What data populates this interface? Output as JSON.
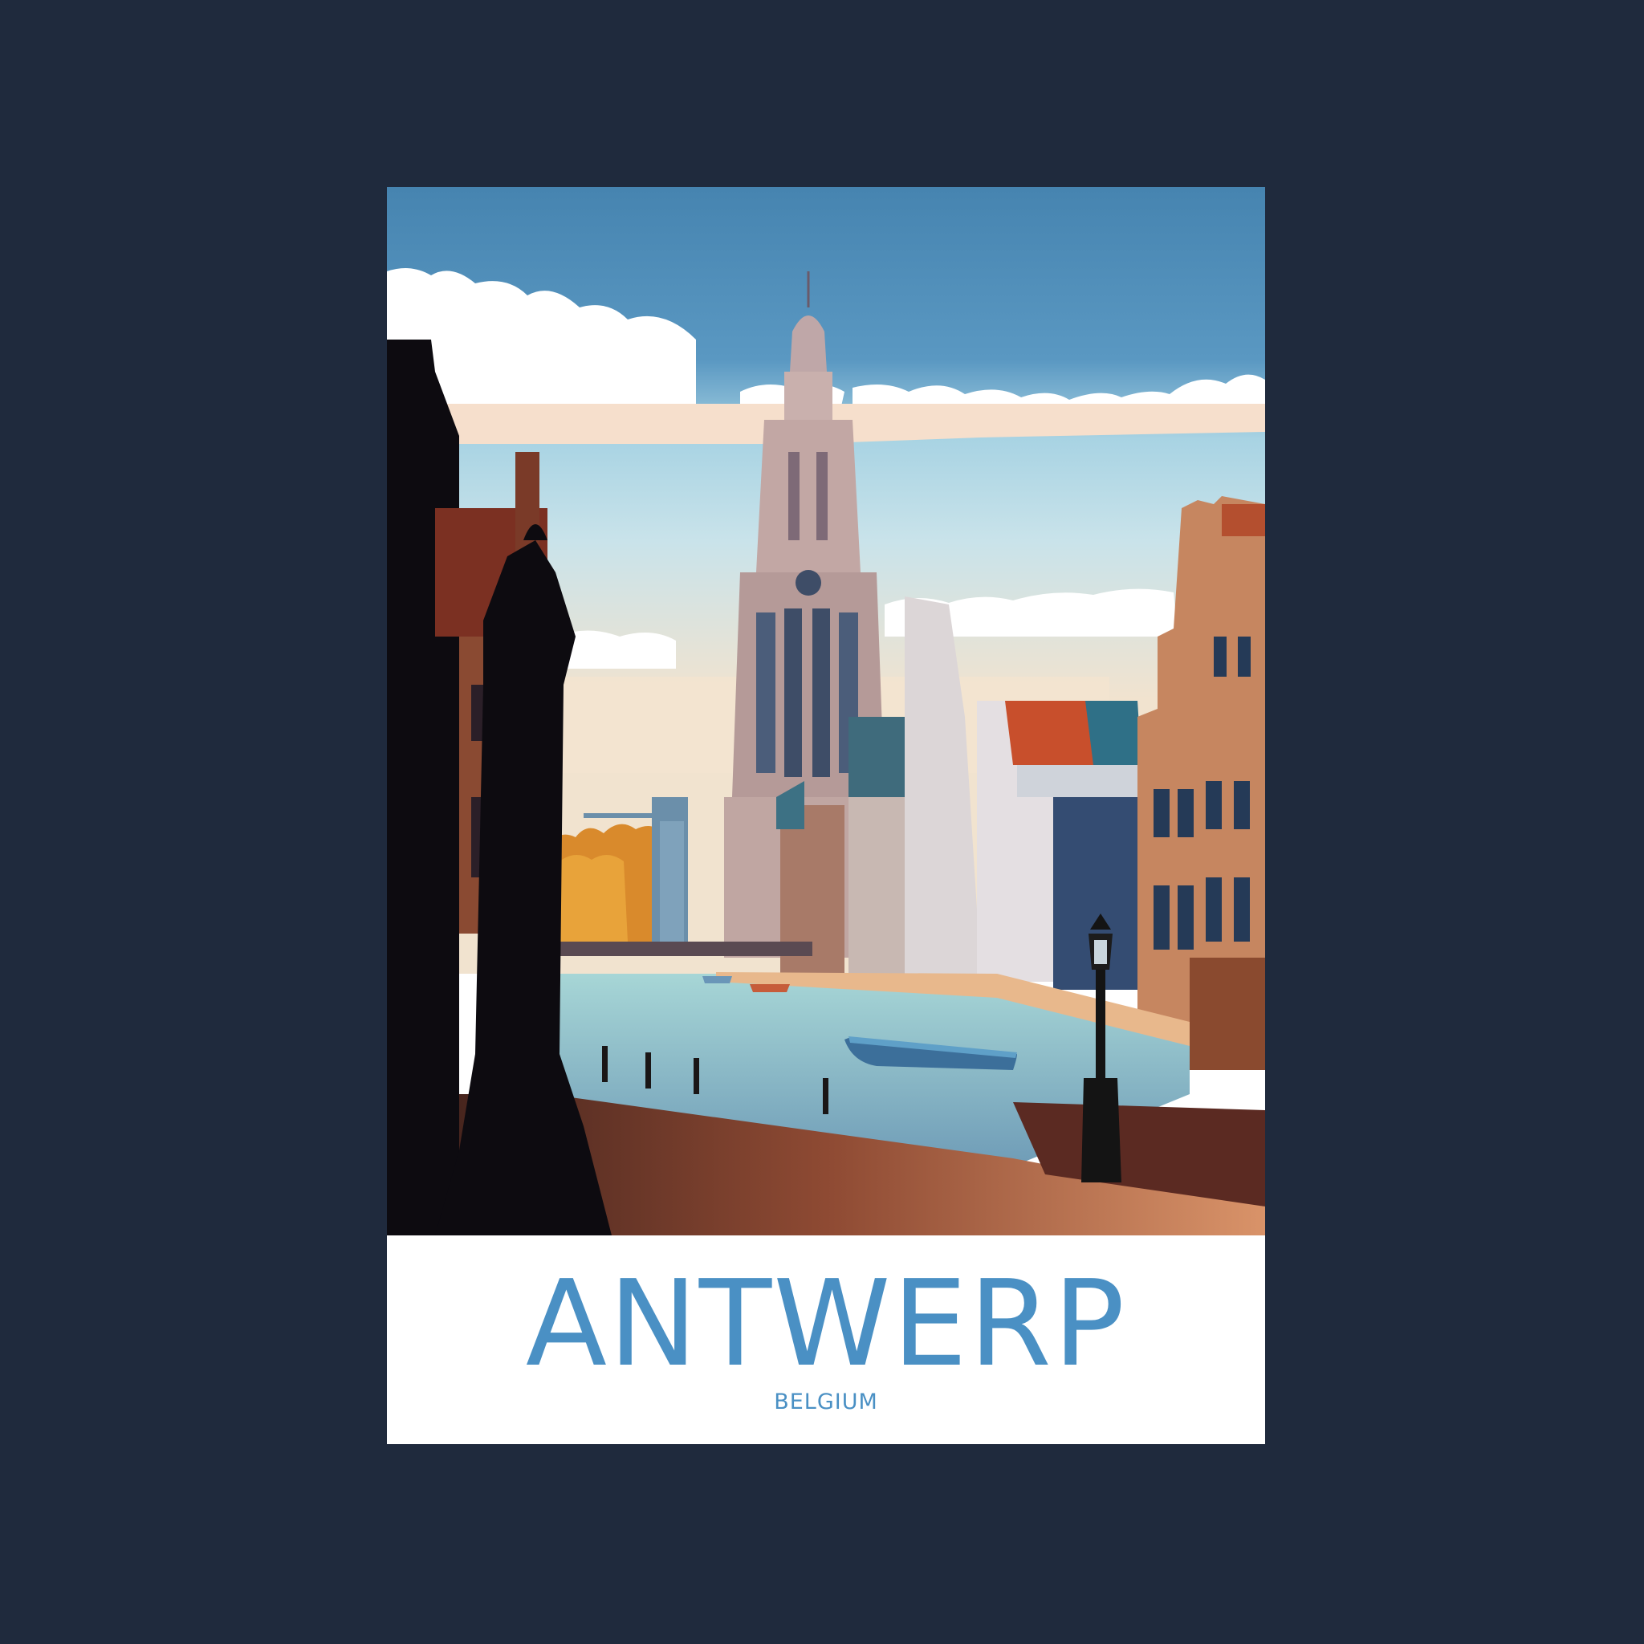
{
  "poster": {
    "title": "ANTWERP",
    "subtitle": "BELGIUM"
  },
  "colors": {
    "background": "#1f2a3d",
    "poster_paper": "#ffffff",
    "title_text": "#4a90c4",
    "sky": "#4684b0"
  }
}
